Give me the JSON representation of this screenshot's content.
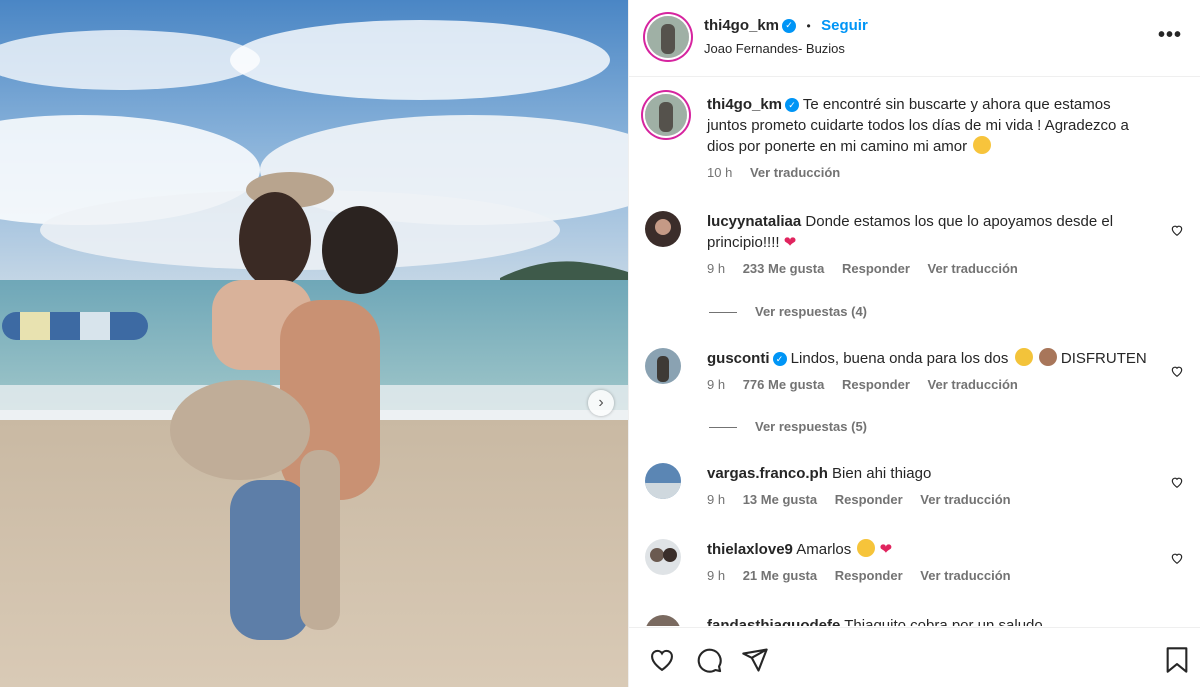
{
  "post": {
    "username": "thi4go_km",
    "follow_label": "Seguir",
    "separator": "•",
    "location": "Joao Fernandes- Buzios",
    "more_label": "•••"
  },
  "caption": {
    "username": "thi4go_km",
    "text": "Te encontré sin buscarte y ahora que estamos juntos prometo cuidarte todos los días de mi vida ! Agradezco a dios por ponerte en mi camino mi amor",
    "time": "10 h",
    "translate_label": "Ver traducción"
  },
  "comments": [
    {
      "username": "lucyynataliaa",
      "text": "Donde estamos los que lo apoyamos desde el principio!!!!",
      "time": "9 h",
      "likes": "233 Me gusta",
      "reply_label": "Responder",
      "translate_label": "Ver traducción",
      "replies_label": "Ver respuestas (4)"
    },
    {
      "username": "gusconti",
      "text": "Lindos, buena onda para los dos",
      "suffix": "DISFRUTEN",
      "time": "9 h",
      "likes": "776 Me gusta",
      "reply_label": "Responder",
      "translate_label": "Ver traducción",
      "replies_label": "Ver respuestas (5)"
    },
    {
      "username": "vargas.franco.ph",
      "text": "Bien ahi thiago",
      "time": "9 h",
      "likes": "13 Me gusta",
      "reply_label": "Responder",
      "translate_label": "Ver traducción"
    },
    {
      "username": "thielaxlove9",
      "text": "Amarlos",
      "time": "9 h",
      "likes": "21 Me gusta",
      "reply_label": "Responder",
      "translate_label": "Ver traducción"
    },
    {
      "username": "fandasthiaguodefe",
      "text": "Thiaguito cobra por un saludo"
    }
  ],
  "icons": {
    "like": "heart-icon",
    "comment": "comment-icon",
    "share": "share-icon",
    "save": "bookmark-icon",
    "next": "chevron-right-icon"
  },
  "colors": {
    "accent": "#0095f6",
    "text": "#262626",
    "muted": "#737373",
    "border": "#efefef"
  }
}
